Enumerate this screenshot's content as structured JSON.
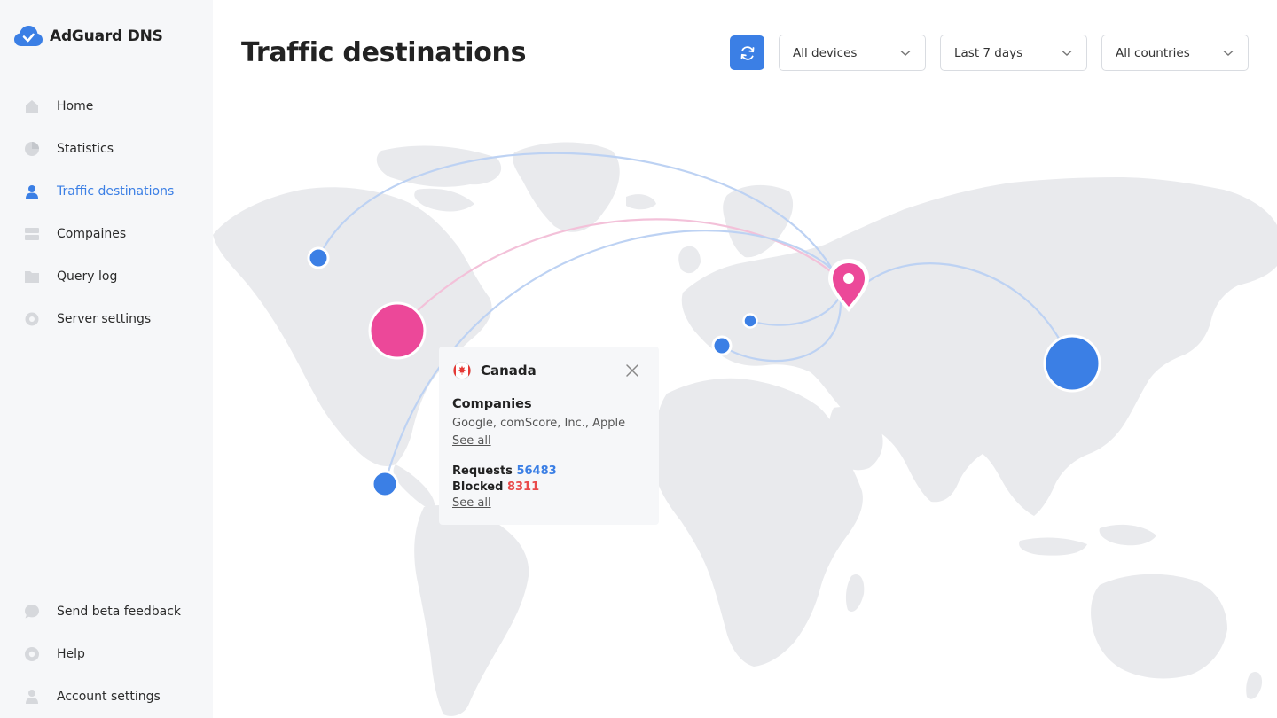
{
  "app": {
    "name": "AdGuard DNS"
  },
  "sidebar": {
    "items": [
      {
        "label": "Home",
        "icon": "home-icon"
      },
      {
        "label": "Statistics",
        "icon": "pie-chart-icon"
      },
      {
        "label": "Traffic destinations",
        "icon": "user-location-icon",
        "active": true
      },
      {
        "label": "Compaines",
        "icon": "server-icon"
      },
      {
        "label": "Query log",
        "icon": "folder-icon"
      },
      {
        "label": "Server settings",
        "icon": "gear-icon"
      }
    ],
    "bottom_items": [
      {
        "label": "Send beta feedback",
        "icon": "chat-icon"
      },
      {
        "label": "Help",
        "icon": "help-icon"
      },
      {
        "label": "Account settings",
        "icon": "user-icon"
      }
    ]
  },
  "header": {
    "title": "Traffic destinations",
    "filters": {
      "devices": "All devices",
      "period": "Last 7 days",
      "countries": "All countries"
    }
  },
  "popup": {
    "country": "Canada",
    "companies_heading": "Companies",
    "companies": "Google, comScore, Inc., Apple",
    "see_all": "See all",
    "requests_label": "Requests",
    "requests_value": "56483",
    "blocked_label": "Blocked",
    "blocked_value": "8311"
  },
  "colors": {
    "accent": "#3b7fe5",
    "pink": "#ec4899",
    "blocked": "#e94b4b",
    "land": "#e9eaed"
  }
}
